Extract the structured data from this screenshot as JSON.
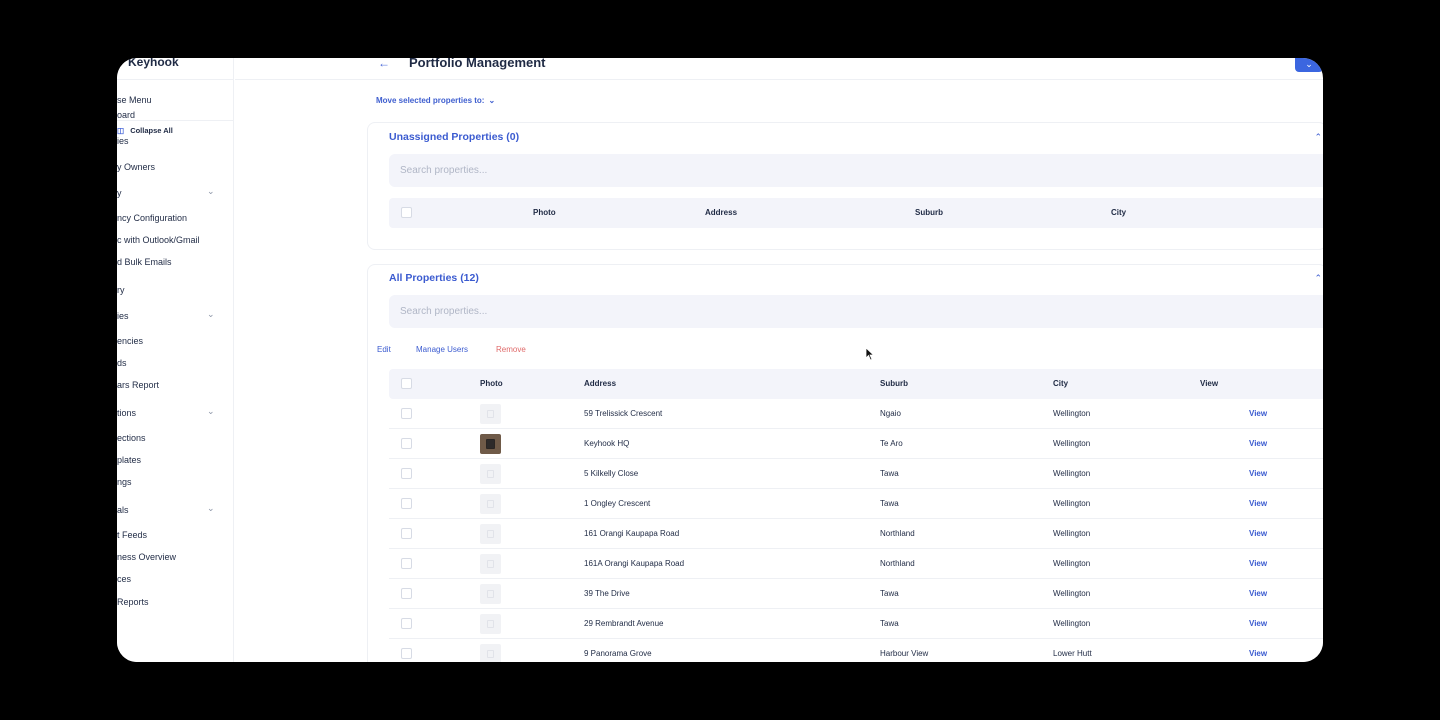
{
  "app": {
    "name": "Keyhook"
  },
  "sidebar": {
    "collapse_menu": "se Menu",
    "collapse_all": "Collapse All",
    "items": [
      {
        "label": "oard",
        "chevron": false
      },
      {
        "label": "ies",
        "chevron": false
      },
      {
        "label": "y Owners",
        "chevron": false
      },
      {
        "label": "y",
        "chevron": true
      },
      {
        "label": "ncy Configuration",
        "chevron": false
      },
      {
        "label": "c with Outlook/Gmail",
        "chevron": false
      },
      {
        "label": "d Bulk Emails",
        "chevron": false
      },
      {
        "label": "ry",
        "chevron": false
      },
      {
        "label": "ies",
        "chevron": true
      },
      {
        "label": "encies",
        "chevron": false
      },
      {
        "label": "ds",
        "chevron": false
      },
      {
        "label": "ars Report",
        "chevron": false
      },
      {
        "label": "tions",
        "chevron": true
      },
      {
        "label": "ections",
        "chevron": false
      },
      {
        "label": "plates",
        "chevron": false
      },
      {
        "label": "ngs",
        "chevron": false
      },
      {
        "label": "als",
        "chevron": true
      },
      {
        "label": "t Feeds",
        "chevron": false
      },
      {
        "label": "ness Overview",
        "chevron": false
      },
      {
        "label": "ces",
        "chevron": false
      },
      {
        "label": "Reports",
        "chevron": false
      }
    ]
  },
  "header": {
    "back_icon": "arrow-left-icon",
    "title": "Portfolio Management"
  },
  "move_selected": {
    "label": "Move selected properties to:",
    "chevron": "⌄"
  },
  "unassigned": {
    "title": "Unassigned Properties (0)",
    "search_placeholder": "Search properties...",
    "columns": [
      "Photo",
      "Address",
      "Suburb",
      "City"
    ]
  },
  "all_properties": {
    "title": "All Properties (12)",
    "search_placeholder": "Search properties...",
    "actions": {
      "edit": "Edit",
      "manage_users": "Manage Users",
      "remove": "Remove"
    },
    "columns": [
      "Photo",
      "Address",
      "Suburb",
      "City",
      "View"
    ],
    "rows": [
      {
        "address": "59 Trelissick Crescent",
        "suburb": "Ngaio",
        "city": "Wellington",
        "view": "View",
        "photo": false
      },
      {
        "address": "Keyhook HQ",
        "suburb": "Te Aro",
        "city": "Wellington",
        "view": "View",
        "photo": true
      },
      {
        "address": "5 Kilkelly Close",
        "suburb": "Tawa",
        "city": "Wellington",
        "view": "View",
        "photo": false
      },
      {
        "address": "1 Ongley Crescent",
        "suburb": "Tawa",
        "city": "Wellington",
        "view": "View",
        "photo": false
      },
      {
        "address": "161 Orangi Kaupapa Road",
        "suburb": "Northland",
        "city": "Wellington",
        "view": "View",
        "photo": false
      },
      {
        "address": "161A Orangi Kaupapa Road",
        "suburb": "Northland",
        "city": "Wellington",
        "view": "View",
        "photo": false
      },
      {
        "address": "39 The Drive",
        "suburb": "Tawa",
        "city": "Wellington",
        "view": "View",
        "photo": false
      },
      {
        "address": "29 Rembrandt Avenue",
        "suburb": "Tawa",
        "city": "Wellington",
        "view": "View",
        "photo": false
      },
      {
        "address": "9 Panorama Grove",
        "suburb": "Harbour View",
        "city": "Lower Hutt",
        "view": "View",
        "photo": false
      }
    ]
  },
  "colors": {
    "accent": "#3b5bd0",
    "remove": "#e06b6b",
    "text": "#1f2a44",
    "search_bg": "#f3f4fa"
  }
}
